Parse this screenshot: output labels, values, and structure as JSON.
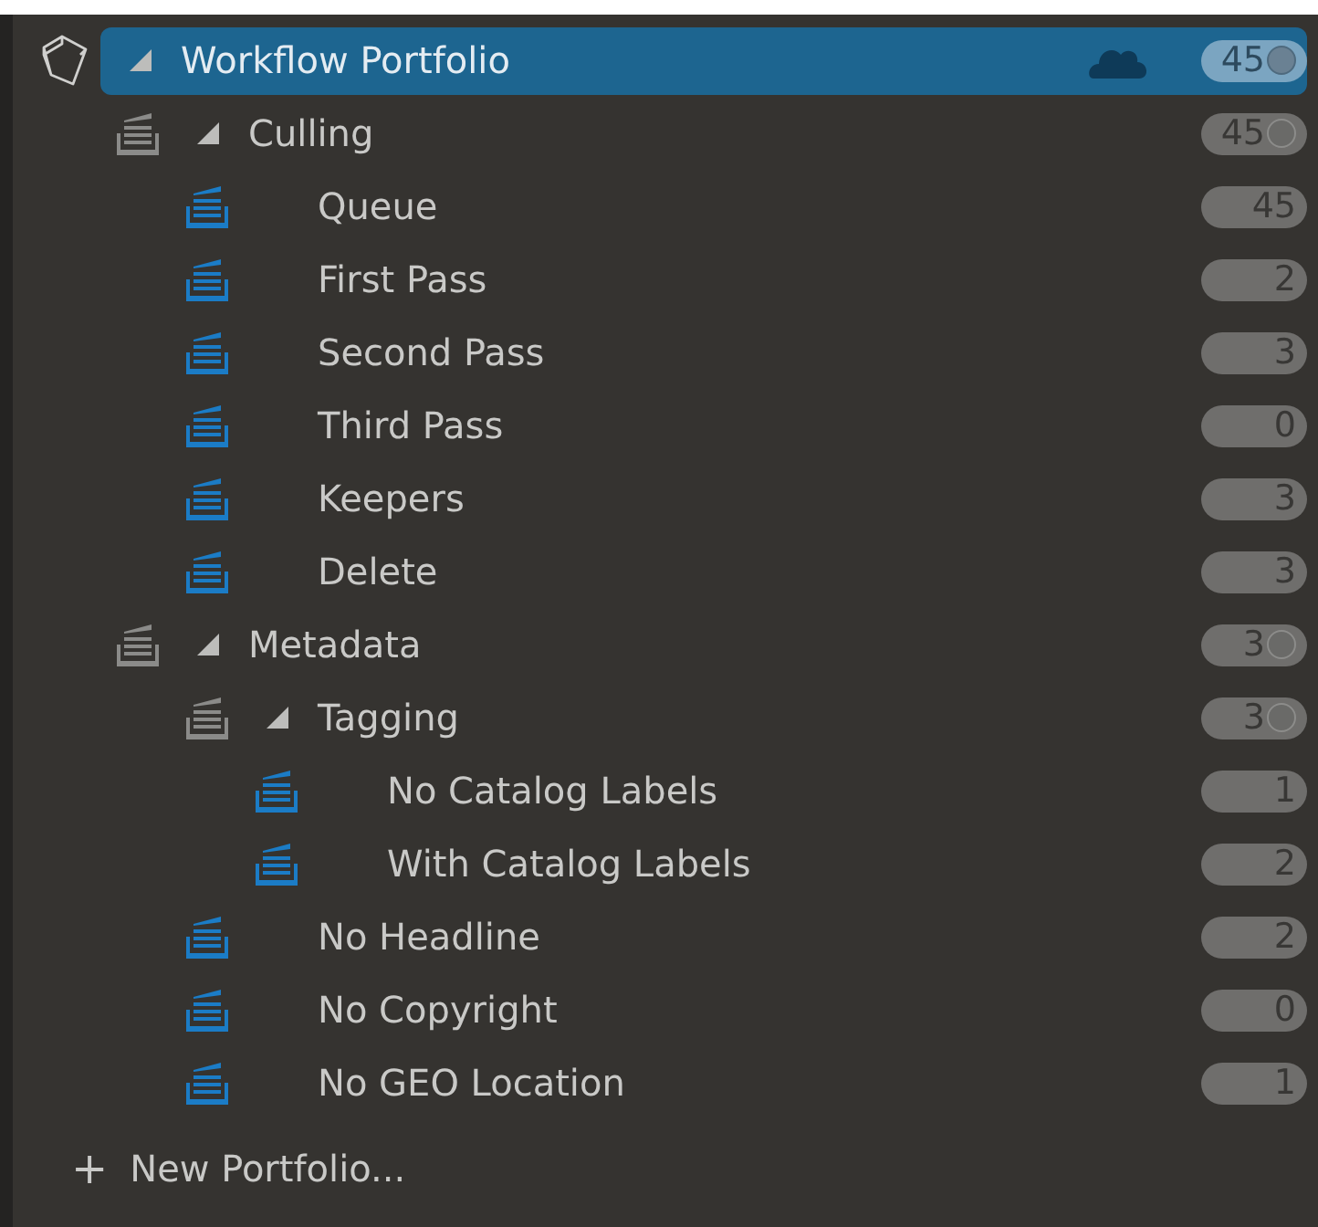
{
  "portfolio": {
    "label": "Workflow Portfolio",
    "count": "45",
    "selected": true,
    "expanded": true,
    "synced": true,
    "children": [
      {
        "kind": "group",
        "label": "Culling",
        "count": "45",
        "expanded": true,
        "children": [
          {
            "kind": "collection",
            "label": "Queue",
            "count": "45"
          },
          {
            "kind": "collection",
            "label": "First Pass",
            "count": "2"
          },
          {
            "kind": "collection",
            "label": "Second Pass",
            "count": "3"
          },
          {
            "kind": "collection",
            "label": "Third Pass",
            "count": "0"
          },
          {
            "kind": "collection",
            "label": "Keepers",
            "count": "3"
          },
          {
            "kind": "collection",
            "label": "Delete",
            "count": "3"
          }
        ]
      },
      {
        "kind": "group",
        "label": "Metadata",
        "count": "3",
        "expanded": true,
        "children": [
          {
            "kind": "group",
            "label": "Tagging",
            "count": "3",
            "expanded": true,
            "children": [
              {
                "kind": "collection",
                "label": "No Catalog Labels",
                "count": "1"
              },
              {
                "kind": "collection",
                "label": "With Catalog Labels",
                "count": "2"
              }
            ]
          },
          {
            "kind": "collection",
            "label": "No Headline",
            "count": "2"
          },
          {
            "kind": "collection",
            "label": "No Copyright",
            "count": "0"
          },
          {
            "kind": "collection",
            "label": "No GEO Location",
            "count": "1"
          }
        ]
      }
    ]
  },
  "new_portfolio": {
    "icon": "+",
    "label": "New Portfolio..."
  }
}
